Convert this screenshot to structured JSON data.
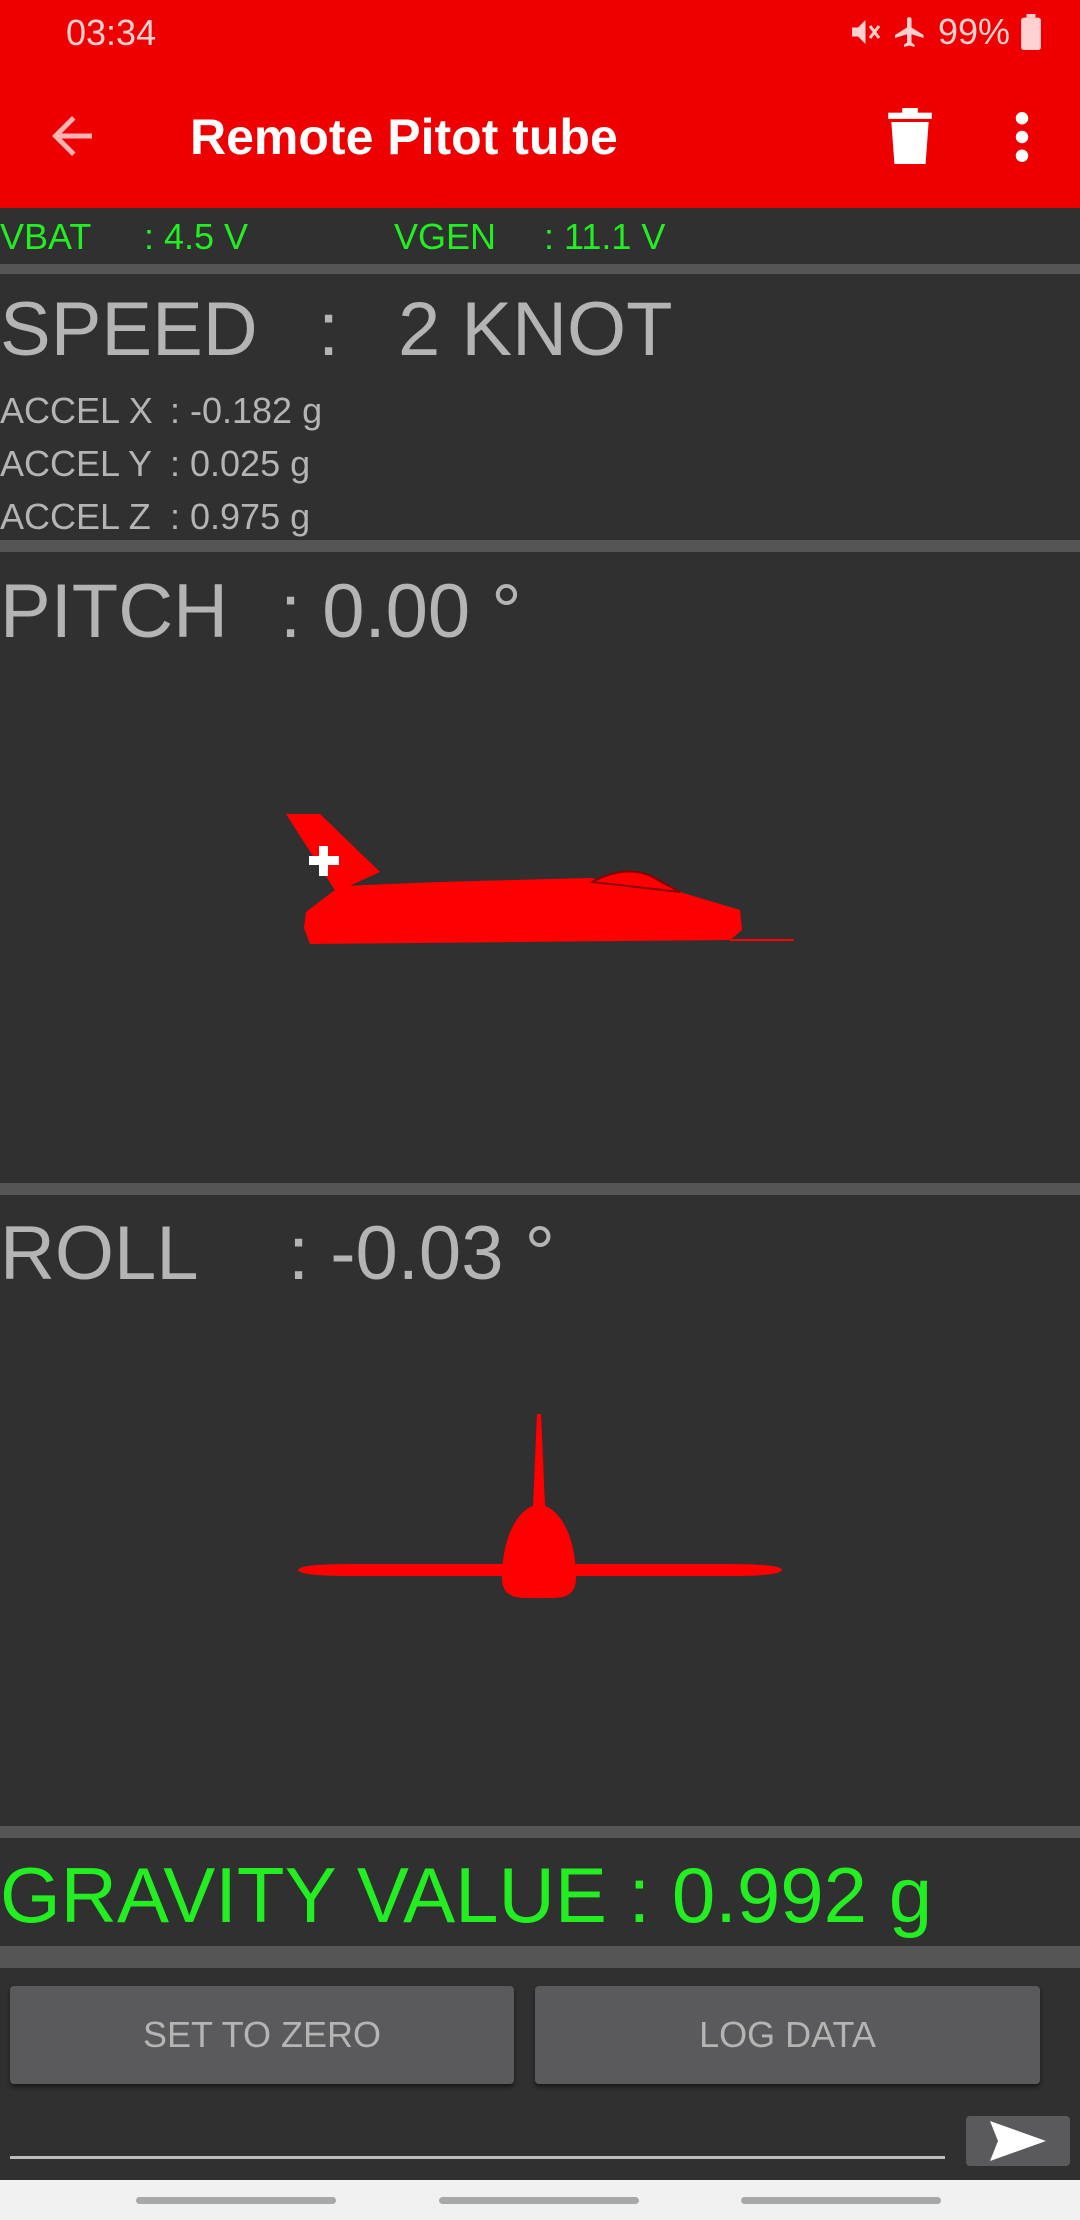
{
  "status_bar": {
    "time": "03:34",
    "battery": "99%",
    "icons": [
      "mute-icon",
      "airplane-mode-icon",
      "battery-icon"
    ]
  },
  "appbar": {
    "title": "Remote Pitot tube",
    "icons": [
      "back-arrow-icon",
      "trash-icon",
      "more-vert-icon"
    ]
  },
  "voltages": {
    "vbat_label": "VBAT",
    "vbat_value": ": 4.5 V",
    "vgen_label": "VGEN",
    "vgen_value": ": 11.1 V"
  },
  "speed": {
    "label": "SPEED",
    "sep": ":",
    "value": "2 KNOT"
  },
  "accel": [
    {
      "label": "ACCEL X",
      "value": ": -0.182 g"
    },
    {
      "label": "ACCEL Y",
      "value": ": 0.025 g"
    },
    {
      "label": "ACCEL Z",
      "value": ": 0.975 g"
    }
  ],
  "pitch": {
    "label": "PITCH",
    "value": ": 0.00 °"
  },
  "roll": {
    "label": "ROLL",
    "value": ": -0.03 °"
  },
  "gravity": {
    "text": "GRAVITY VALUE : 0.992 g"
  },
  "buttons": {
    "set_zero": "SET TO ZERO",
    "log_data": "LOG DATA"
  },
  "colors": {
    "appbar": "#ee0000",
    "background": "#303030",
    "accent_green": "#22ee22",
    "aircraft": "#ff0000"
  }
}
